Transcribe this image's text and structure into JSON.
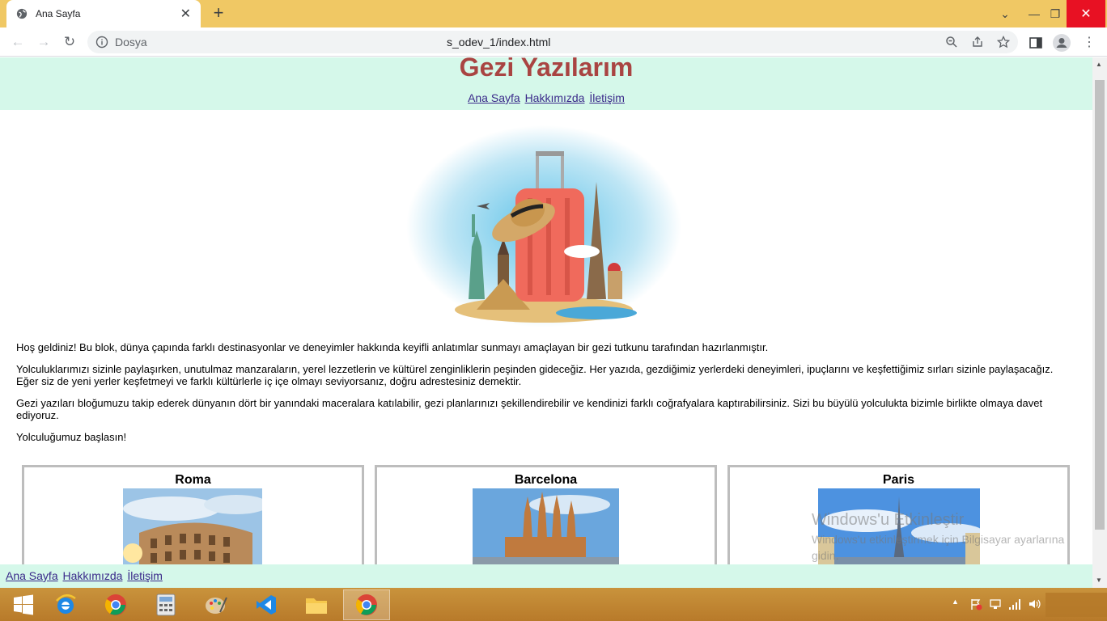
{
  "browser": {
    "tab_title": "Ana Sayfa",
    "scheme_label": "Dosya",
    "url": "s_odev_1/index.html"
  },
  "page": {
    "title": "Gezi Yazılarım",
    "nav": [
      "Ana Sayfa",
      "Hakkımızda",
      "İletişim"
    ],
    "paragraphs": [
      "Hoş geldiniz! Bu blok, dünya çapında farklı destinasyonlar ve deneyimler hakkında keyifli anlatımlar sunmayı amaçlayan bir gezi tutkunu tarafından hazırlanmıştır.",
      "Yolculuklarımızı sizinle paylaşırken, unutulmaz manzaraların, yerel lezzetlerin ve kültürel zenginliklerin peşinden gideceğiz. Her yazıda, gezdiğimiz yerlerdeki deneyimleri, ipuçlarını ve keşfettiğimiz sırları sizinle paylaşacağız. Eğer siz de yeni yerler keşfetmeyi ve farklı kültürlerle iç içe olmayı seviyorsanız, doğru adrestesiniz demektir.",
      "Gezi yazıları bloğumuzu takip ederek dünyanın dört bir yanındaki maceralara katılabilir, gezi planlarınızı şekillendirebilir ve kendinizi farklı coğrafyalara kaptırabilirsiniz. Sizi bu büyülü yolculukta bizimle birlikte olmaya davet ediyoruz.",
      "Yolculuğumuz başlasın!"
    ],
    "cards": [
      "Roma",
      "Barcelona",
      "Paris"
    ],
    "footer_nav": [
      "Ana Sayfa",
      "Hakkımızda",
      "İletişim"
    ]
  },
  "watermark": {
    "line1": "Windows'u Etkinleştir",
    "line2": "Windows'u etkinleştirmek için Bilgisayar ayarlarına gidin."
  },
  "colors": {
    "titlebar": "#f0c864",
    "header_bg": "#d5f8ea",
    "title_color": "#a94442",
    "link_color": "#3a2a8a"
  }
}
